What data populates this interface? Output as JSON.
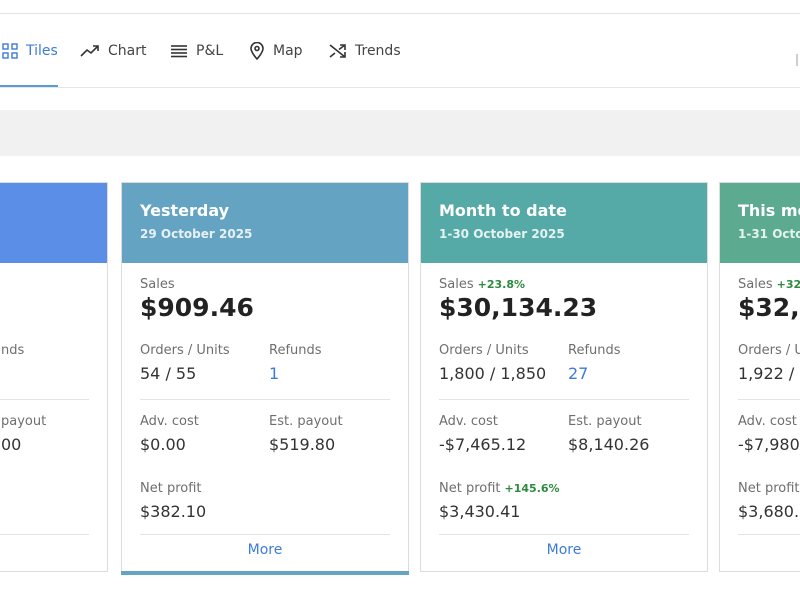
{
  "tabs": [
    {
      "label": "Tiles",
      "icon": "grid-icon",
      "active": true
    },
    {
      "label": "Chart",
      "icon": "trend-line-icon",
      "active": false
    },
    {
      "label": "P&L",
      "icon": "list-icon",
      "active": false
    },
    {
      "label": "Map",
      "icon": "location-pin-icon",
      "active": false
    },
    {
      "label": "Trends",
      "icon": "shuffle-icon",
      "active": false
    }
  ],
  "colors": {
    "accent": "#3d7bd9",
    "today_header": "#5b8ee6",
    "yesterday_header": "#64a3c2",
    "month_header": "#55aaa8",
    "this_month_header": "#5cab91",
    "positive": "#2e8b3d"
  },
  "cards": [
    {
      "title": "",
      "subtitle": "",
      "sales_label": "",
      "sales_change": "",
      "sales_value": "",
      "orders_label": "",
      "orders_value": "",
      "refunds_label": "nds",
      "refunds_value": "",
      "adv_label": "",
      "adv_value": "",
      "payout_label": "payout",
      "payout_value": "00",
      "profit_label": "",
      "profit_change": "",
      "profit_value": "",
      "more": ""
    },
    {
      "title": "Yesterday",
      "subtitle": "29 October 2025",
      "sales_label": "Sales",
      "sales_change": "",
      "sales_value": "$909.46",
      "orders_label": "Orders / Units",
      "orders_value": "54 / 55",
      "refunds_label": "Refunds",
      "refunds_value": "1",
      "adv_label": "Adv. cost",
      "adv_value": "$0.00",
      "payout_label": "Est. payout",
      "payout_value": "$519.80",
      "profit_label": "Net profit",
      "profit_change": "",
      "profit_value": "$382.10",
      "more": "More"
    },
    {
      "title": "Month to date",
      "subtitle": "1-30 October 2025",
      "sales_label": "Sales",
      "sales_change": "+23.8%",
      "sales_value": "$30,134.23",
      "orders_label": "Orders / Units",
      "orders_value": "1,800 / 1,850",
      "refunds_label": "Refunds",
      "refunds_value": "27",
      "adv_label": "Adv. cost",
      "adv_value": "-$7,465.12",
      "payout_label": "Est. payout",
      "payout_value": "$8,140.26",
      "profit_label": "Net profit",
      "profit_change": "+145.6%",
      "profit_value": "$3,430.41",
      "more": "More"
    },
    {
      "title": "This mo",
      "subtitle": "1-31 Octo",
      "sales_label": "Sales",
      "sales_change": "+32.",
      "sales_value": "$32,1",
      "orders_label": "Orders / U",
      "orders_value": "1,922 / 1",
      "refunds_label": "",
      "refunds_value": "",
      "adv_label": "Adv. cost",
      "adv_value": "-$7,980.",
      "payout_label": "",
      "payout_value": "",
      "profit_label": "Net profit",
      "profit_change": "",
      "profit_value": "$3,680.3",
      "more": ""
    }
  ]
}
